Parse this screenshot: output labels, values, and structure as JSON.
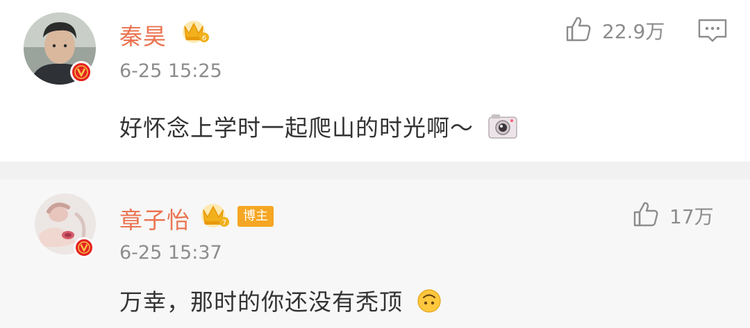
{
  "comments": [
    {
      "user": "秦昊",
      "crown_level": "6",
      "time": "6-25 15:25",
      "text": "好怀念上学时一起爬山的时光啊～",
      "text_emoji": "camera-emoji",
      "likes": "22.9万",
      "colors": {
        "name": "#eb7350",
        "verified": "#e52323"
      }
    },
    {
      "user": "章子怡",
      "crown_level": "7",
      "tag": "博主",
      "time": "6-25 15:37",
      "text": "万幸，那时的你还没有秃顶",
      "text_emoji": "upside-down-face-emoji",
      "likes": "17万",
      "colors": {
        "name": "#eb7350",
        "tag": "#f5a623"
      }
    }
  ],
  "icons": {
    "like": "thumbs-up-icon",
    "reply": "comment-icon",
    "verified": "verified-v-badge",
    "crown": "crown-badge"
  }
}
